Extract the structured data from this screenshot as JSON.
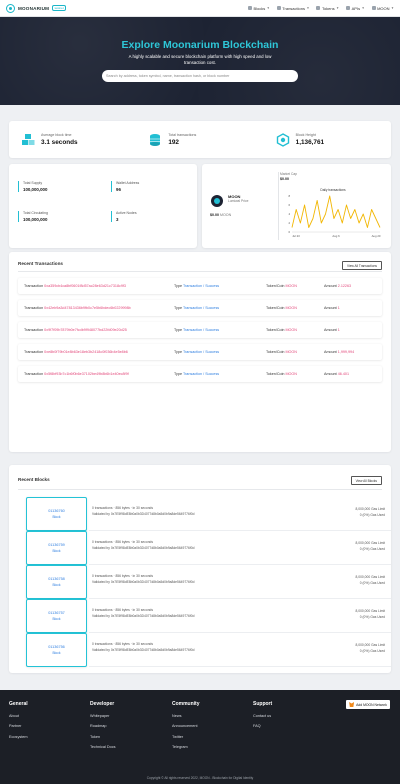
{
  "nav": {
    "brand": "MOONARIUM",
    "brand_badge": "testnet",
    "menu": [
      {
        "label": "Blocks",
        "icon": "cube-icon"
      },
      {
        "label": "Transactions",
        "icon": "exchange-icon"
      },
      {
        "label": "Tokens",
        "icon": "token-icon"
      },
      {
        "label": "APIs",
        "icon": "code-icon"
      },
      {
        "label": "MOON",
        "icon": "moon-icon"
      }
    ]
  },
  "hero": {
    "title": "Explore Moonarium Blockchain",
    "subtitle": "A highly scalable and secure blockchain platform with high speed and low transaction cost.",
    "search_placeholder": "Search by address, token symbol, name, transaction hash, or block number"
  },
  "stats": [
    {
      "label": "Average block time",
      "value": "3.1 seconds",
      "icon": "blocks-icon"
    },
    {
      "label": "Total transactions",
      "value": "192",
      "icon": "coins-stack-icon"
    },
    {
      "label": "Block Height",
      "value": "1,136,761",
      "icon": "network-icon"
    }
  ],
  "supply": {
    "total_supply_label": "Total Supply",
    "total_supply_value": "100,000,000",
    "wallet_label": "Wallet Address",
    "wallet_value": "96",
    "circulating_label": "Total Circulating",
    "circulating_value": "100,000,000",
    "nodes_label": "Active Nodes",
    "nodes_value": "3"
  },
  "market": {
    "coin_name": "MOON",
    "coin_sub": "Lumiwal Price",
    "price": "$0.00",
    "price_unit": "MOON",
    "cap_label": "Market Cap",
    "cap_value": "$0.00"
  },
  "chart_data": {
    "type": "line",
    "title": "Daily transactions",
    "x": [
      "Jul 23",
      "Aug 6",
      "Aug 20"
    ],
    "y_ticks": [
      0,
      2,
      4,
      6,
      8
    ],
    "ylim": [
      0,
      8
    ],
    "series": [
      {
        "name": "Daily transactions",
        "color": "#f2b705",
        "values": [
          1,
          5,
          2,
          6,
          1,
          3,
          7,
          2,
          4,
          8,
          3,
          5,
          2,
          6,
          3,
          5,
          2,
          4,
          1,
          5,
          3,
          1
        ]
      }
    ]
  },
  "transactions": {
    "title": "Recent Transactions",
    "view_all": "View All Transactions",
    "rows": [
      {
        "label": "Transaction",
        "hash": "0xa359cb4ca8bf0601f8d57ac28e63d21c7318c9f3",
        "type_label": "Type",
        "type": "Transaction",
        "status": "Success",
        "token_label": "Token/Coin",
        "token": "MOON",
        "amount_label": "Amount",
        "amount": "2.12263"
      },
      {
        "label": "Transaction",
        "hash": "0x42eb9a3d47813436b9fb0c7e5b6bdec6b0229998b",
        "type_label": "Type",
        "type": "Transaction",
        "status": "Success",
        "token_label": "Token/Coin",
        "token": "MOON",
        "amount_label": "Amount",
        "amount": "1"
      },
      {
        "label": "Transaction",
        "hash": "0x9f7f09b7879b0e7fcdb9f948077bd22fd09e20d25",
        "type_label": "Type",
        "type": "Transaction",
        "status": "Success",
        "token_label": "Token/Coin",
        "token": "MOON",
        "amount_label": "Amount",
        "amount": "1"
      },
      {
        "label": "Transaction",
        "hash": "0xe8b0f79b01e8b63e18eb3b2418c0f036b4e5e8b6",
        "type_label": "Type",
        "type": "Transaction",
        "status": "Success",
        "token_label": "Token/Coin",
        "token": "MOON",
        "amount_label": "Amount",
        "amount": "1,999,994"
      },
      {
        "label": "Transaction",
        "hash": "0x5f8bf93b7c1b6f0b6e37102be49b8b6b1e40ec8f9f",
        "type_label": "Type",
        "type": "Transaction",
        "status": "Success",
        "token_label": "Token/Coin",
        "token": "MOON",
        "amount_label": "Amount",
        "amount": "46.401"
      }
    ]
  },
  "blocks": {
    "title": "Recent Blocks",
    "view_all": "View All Blocks",
    "rows": [
      {
        "number": "01136760",
        "age": "Block",
        "line1": "0 transactions  ·  856 bytes  ·  in 30 seconds",
        "line2": "Validated by 0x7E5f98dE8b0a0b3D4077d8b0a5d0b9a8de5649776f0d",
        "gas": "8,000,000 Gas Limit",
        "used": "0 (0%) Gas Used"
      },
      {
        "number": "01136759",
        "age": "Block",
        "line1": "0 transactions  ·  856 bytes  ·  in 30 seconds",
        "line2": "Validated by 0x7E5f98dE8b0a0b3D4077d8b0a5d0b9a8de5649776f0d",
        "gas": "8,000,000 Gas Limit",
        "used": "0 (0%) Gas Used"
      },
      {
        "number": "01136758",
        "age": "Block",
        "line1": "0 transactions  ·  856 bytes  ·  in 30 seconds",
        "line2": "Validated by 0x7E5f98dE8b0a0b3D4077d8b0a5d0b9a8de5649776f0d",
        "gas": "8,000,000 Gas Limit",
        "used": "0 (0%) Gas Used"
      },
      {
        "number": "01136757",
        "age": "Block",
        "line1": "0 transactions  ·  856 bytes  ·  in 30 seconds",
        "line2": "Validated by 0x7E5f98dE8b0a0b3D4077d8b0a5d0b9a8de5649776f0d",
        "gas": "8,000,000 Gas Limit",
        "used": "0 (0%) Gas Used"
      },
      {
        "number": "01136756",
        "age": "Block",
        "line1": "0 transactions  ·  856 bytes  ·  in 30 seconds",
        "line2": "Validated by 0x7E5f98dE8b0a0b3D4077d8b0a5d0b9a8de5649776f0d",
        "gas": "8,000,000 Gas Limit",
        "used": "0 (0%) Gas Used"
      }
    ]
  },
  "footer": {
    "add_network": "Add MOON Network",
    "columns": [
      {
        "title": "General",
        "links": [
          "About",
          "Partner",
          "Ecosystem"
        ]
      },
      {
        "title": "Developer",
        "links": [
          "Whitepaper",
          "Roadmap",
          "Token",
          "Technical Docs"
        ]
      },
      {
        "title": "Community",
        "links": [
          "News",
          "Announcement",
          "Twitter",
          "Telegram"
        ]
      },
      {
        "title": "Support",
        "links": [
          "Contact us",
          "FAQ"
        ]
      }
    ],
    "copyright": "Copyright © All rights reserved 2022, MOON - Blockchain for Digital Identity"
  },
  "colors": {
    "accent": "#22bfd3",
    "hero_bg": "#1d2333",
    "link_pink": "#e2477a",
    "link_blue": "#2f7fe0",
    "footer_bg": "#1c1f26"
  }
}
